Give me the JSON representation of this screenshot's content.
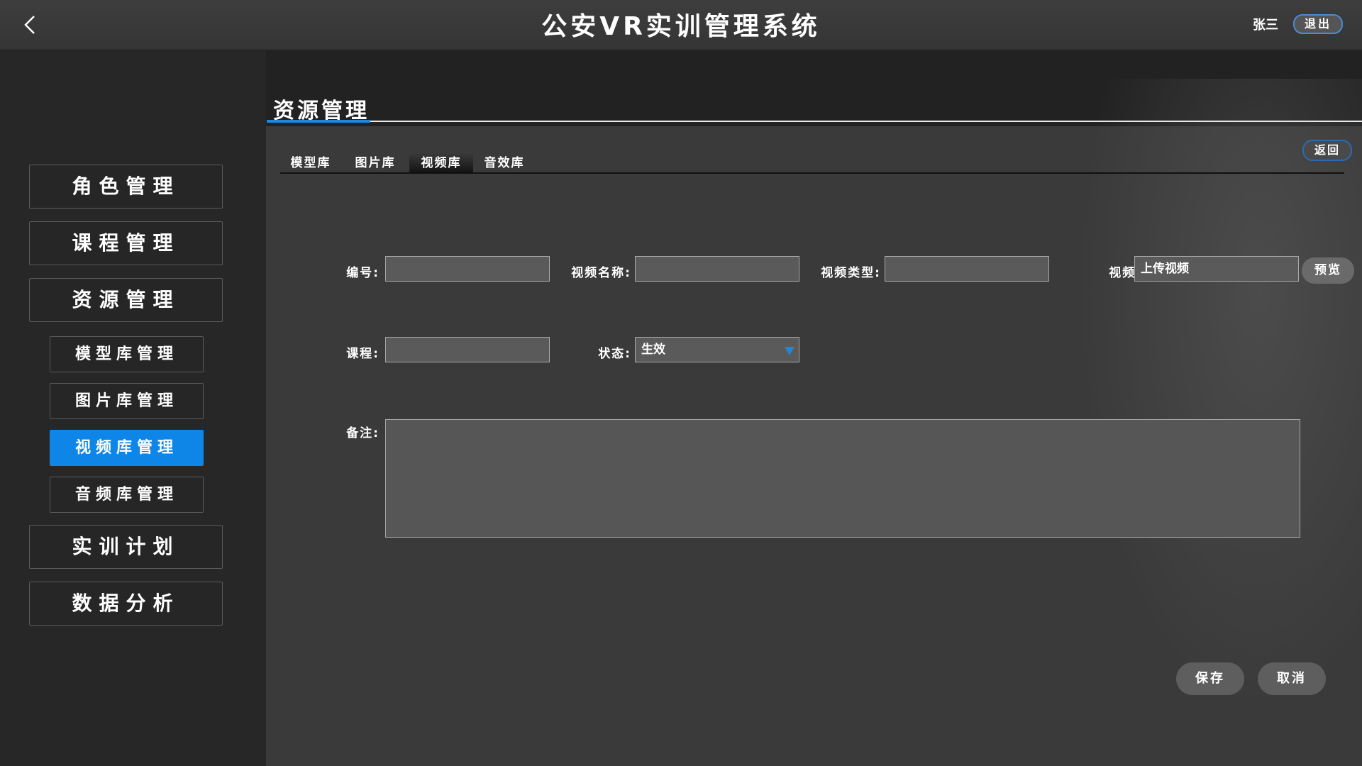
{
  "header": {
    "title": "公安VR实训管理系统",
    "user_name": "张三",
    "logout_label": "退出"
  },
  "sidebar": {
    "menu": [
      {
        "label": "角色管理"
      },
      {
        "label": "课程管理"
      },
      {
        "label": "资源管理"
      },
      {
        "label": "实训计划"
      },
      {
        "label": "数据分析"
      }
    ],
    "submenu": [
      {
        "label": "模型库管理"
      },
      {
        "label": "图片库管理"
      },
      {
        "label": "视频库管理",
        "active": true
      },
      {
        "label": "音频库管理"
      }
    ]
  },
  "main": {
    "section_title": "资源管理",
    "return_label": "返回",
    "tabs": [
      {
        "label": "模型库"
      },
      {
        "label": "图片库"
      },
      {
        "label": "视频库",
        "active": true
      },
      {
        "label": "音效库"
      }
    ],
    "form": {
      "id_label": "编号:",
      "id_value": "",
      "name_label": "视频名称:",
      "name_value": "",
      "type_label": "视频类型:",
      "type_value": "",
      "video_label": "视频:",
      "video_value": "上传视频",
      "preview_label": "预览",
      "course_label": "课程:",
      "course_value": "",
      "status_label": "状态:",
      "status_value": "生效",
      "remark_label": "备注:",
      "remark_value": ""
    },
    "save_label": "保存",
    "cancel_label": "取消"
  },
  "colors": {
    "accent": "#0e86e8",
    "background": "#3a3a3a",
    "sidebar": "#272727"
  }
}
